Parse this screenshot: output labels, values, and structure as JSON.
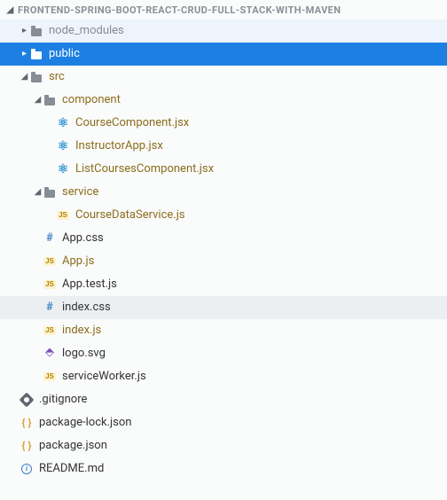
{
  "project_title": "FRONTEND-SPRING-BOOT-REACT-CRUD-FULL-STACK-WITH-MAVEN",
  "tree": [
    {
      "id": "node_modules",
      "label": "node_modules",
      "depth": 0,
      "arrow": "right",
      "icon": "folder",
      "labelClass": "muted",
      "state": "hover"
    },
    {
      "id": "public",
      "label": "public",
      "depth": 0,
      "arrow": "right",
      "icon": "folder",
      "state": "selected"
    },
    {
      "id": "src",
      "label": "src",
      "depth": 0,
      "arrow": "down",
      "icon": "folder",
      "labelClass": "dirchg"
    },
    {
      "id": "component",
      "label": "component",
      "depth": 1,
      "arrow": "down",
      "icon": "folder",
      "labelClass": "dirchg"
    },
    {
      "id": "coursecomp",
      "label": "CourseComponent.jsx",
      "depth": 2,
      "icon": "react",
      "labelClass": "filechg"
    },
    {
      "id": "instructor",
      "label": "InstructorApp.jsx",
      "depth": 2,
      "icon": "react",
      "labelClass": "filechg"
    },
    {
      "id": "listcourses",
      "label": "ListCoursesComponent.jsx",
      "depth": 2,
      "icon": "react",
      "labelClass": "filechg"
    },
    {
      "id": "service",
      "label": "service",
      "depth": 1,
      "arrow": "down",
      "icon": "folder",
      "labelClass": "dirchg"
    },
    {
      "id": "coursedata",
      "label": "CourseDataService.js",
      "depth": 2,
      "icon": "js",
      "labelClass": "filechg"
    },
    {
      "id": "appcss",
      "label": "App.css",
      "depth": 1,
      "icon": "hash"
    },
    {
      "id": "appjs",
      "label": "App.js",
      "depth": 1,
      "icon": "js",
      "labelClass": "filechg"
    },
    {
      "id": "apptest",
      "label": "App.test.js",
      "depth": 1,
      "icon": "js"
    },
    {
      "id": "indexcss",
      "label": "index.css",
      "depth": 1,
      "icon": "hash",
      "state": "hl"
    },
    {
      "id": "indexjs",
      "label": "index.js",
      "depth": 1,
      "icon": "js",
      "labelClass": "filechg"
    },
    {
      "id": "logosvg",
      "label": "logo.svg",
      "depth": 1,
      "icon": "svg"
    },
    {
      "id": "sw",
      "label": "serviceWorker.js",
      "depth": 1,
      "icon": "js"
    },
    {
      "id": "gitignore",
      "label": ".gitignore",
      "depth": 0,
      "icon": "git",
      "noarrowpad": true
    },
    {
      "id": "pkglock",
      "label": "package-lock.json",
      "depth": 0,
      "icon": "braces",
      "noarrowpad": true
    },
    {
      "id": "pkg",
      "label": "package.json",
      "depth": 0,
      "icon": "braces",
      "noarrowpad": true
    },
    {
      "id": "readme",
      "label": "README.md",
      "depth": 0,
      "icon": "info",
      "noarrowpad": true
    }
  ],
  "icon_text": {
    "js": "JS",
    "braces": "{ }",
    "hash": "#",
    "react": "⚛",
    "svg": "⬘",
    "info": "i"
  }
}
